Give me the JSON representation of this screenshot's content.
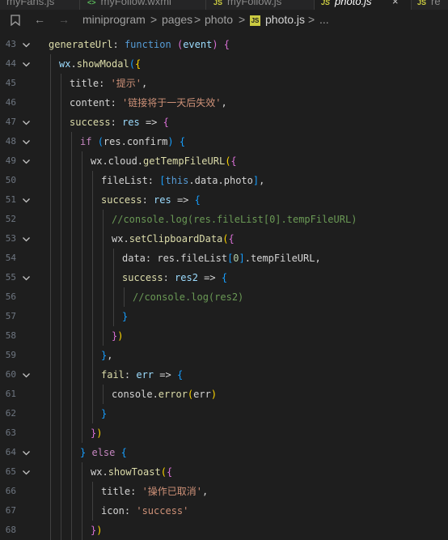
{
  "tabs": [
    {
      "icon": "",
      "label": "myFans.js"
    },
    {
      "icon": "<>",
      "label": "myFollow.wxml"
    },
    {
      "icon": "JS",
      "label": "myFollow.js"
    },
    {
      "icon": "JS",
      "label": "photo.js",
      "close": "×"
    },
    {
      "icon": "JS",
      "label": "re"
    }
  ],
  "breadcrumb": {
    "bookmark": "☐",
    "back": "←",
    "forward": "→",
    "segments": [
      "miniprogram",
      "pages",
      "photo"
    ],
    "sep": ">",
    "file_icon": "JS",
    "file": "photo.js",
    "tail": "..."
  },
  "editor": {
    "lines": [
      {
        "n": "43",
        "fold": true,
        "t": [
          [
            "generateUrl",
            "t-fn"
          ],
          [
            ": ",
            ""
          ],
          [
            "function",
            "t-kw"
          ],
          [
            " ",
            ""
          ],
          [
            "(",
            "t-br2"
          ],
          [
            "event",
            "t-var"
          ],
          [
            ")",
            "t-br2"
          ],
          [
            " ",
            ""
          ],
          [
            "{",
            "t-br2"
          ]
        ]
      },
      {
        "n": "44",
        "fold": true,
        "t": [
          [
            "wx",
            "t-var"
          ],
          [
            ".",
            ""
          ],
          [
            "showModal",
            "t-fn"
          ],
          [
            "(",
            "t-br3"
          ],
          [
            "{",
            "t-br1"
          ]
        ]
      },
      {
        "n": "45",
        "fold": false,
        "t": [
          [
            "title",
            ""
          ],
          [
            ": ",
            ""
          ],
          [
            "'提示'",
            "t-str"
          ],
          [
            ",",
            ""
          ]
        ]
      },
      {
        "n": "46",
        "fold": false,
        "t": [
          [
            "content",
            ""
          ],
          [
            ": ",
            ""
          ],
          [
            "'链接将于一天后失效'",
            "t-str"
          ],
          [
            ",",
            ""
          ]
        ]
      },
      {
        "n": "47",
        "fold": true,
        "t": [
          [
            "success",
            "t-fn"
          ],
          [
            ": ",
            ""
          ],
          [
            "res",
            "t-var"
          ],
          [
            " => ",
            ""
          ],
          [
            "{",
            "t-br2"
          ]
        ]
      },
      {
        "n": "48",
        "fold": true,
        "t": [
          [
            "if",
            "t-ctl"
          ],
          [
            " ",
            ""
          ],
          [
            "(",
            "t-br3"
          ],
          [
            "res.confirm",
            ""
          ],
          [
            ")",
            "t-br3"
          ],
          [
            " ",
            ""
          ],
          [
            "{",
            "t-br3"
          ]
        ]
      },
      {
        "n": "49",
        "fold": true,
        "t": [
          [
            "wx.cloud.",
            ""
          ],
          [
            "getTempFileURL",
            "t-fn"
          ],
          [
            "(",
            "t-br1"
          ],
          [
            "{",
            "t-br2"
          ]
        ]
      },
      {
        "n": "50",
        "fold": false,
        "t": [
          [
            "fileList",
            ""
          ],
          [
            ": ",
            ""
          ],
          [
            "[",
            "t-br3"
          ],
          [
            "this",
            "t-kw"
          ],
          [
            ".data.photo",
            ""
          ],
          [
            "]",
            "t-br3"
          ],
          [
            ",",
            ""
          ]
        ]
      },
      {
        "n": "51",
        "fold": true,
        "t": [
          [
            "success",
            "t-fn"
          ],
          [
            ": ",
            ""
          ],
          [
            "res",
            "t-var"
          ],
          [
            " => ",
            ""
          ],
          [
            "{",
            "t-br3"
          ]
        ]
      },
      {
        "n": "52",
        "fold": false,
        "t": [
          [
            "//console.log(res.fileList[0].tempFileURL)",
            "t-cmt"
          ]
        ]
      },
      {
        "n": "53",
        "fold": true,
        "t": [
          [
            "wx.",
            ""
          ],
          [
            "setClipboardData",
            "t-fn"
          ],
          [
            "(",
            "t-br1"
          ],
          [
            "{",
            "t-br2"
          ]
        ]
      },
      {
        "n": "54",
        "fold": false,
        "t": [
          [
            "data",
            ""
          ],
          [
            ": res.fileList",
            ""
          ],
          [
            "[",
            "t-br3"
          ],
          [
            "0",
            "t-num"
          ],
          [
            "]",
            "t-br3"
          ],
          [
            ".tempFileURL,",
            ""
          ]
        ]
      },
      {
        "n": "55",
        "fold": true,
        "t": [
          [
            "success",
            "t-fn"
          ],
          [
            ": ",
            ""
          ],
          [
            "res2",
            "t-var"
          ],
          [
            " => ",
            ""
          ],
          [
            "{",
            "t-br3"
          ]
        ]
      },
      {
        "n": "56",
        "fold": false,
        "t": [
          [
            "//console.log(res2)",
            "t-cmt"
          ]
        ]
      },
      {
        "n": "57",
        "fold": false,
        "t": [
          [
            "}",
            "t-br3"
          ]
        ]
      },
      {
        "n": "58",
        "fold": false,
        "t": [
          [
            "}",
            "t-br2"
          ],
          [
            ")",
            "t-br1"
          ]
        ]
      },
      {
        "n": "59",
        "fold": false,
        "t": [
          [
            "}",
            "t-br3"
          ],
          [
            ",",
            ""
          ]
        ]
      },
      {
        "n": "60",
        "fold": true,
        "t": [
          [
            "fail",
            "t-fn"
          ],
          [
            ": ",
            ""
          ],
          [
            "err",
            "t-var"
          ],
          [
            " => ",
            ""
          ],
          [
            "{",
            "t-br3"
          ]
        ]
      },
      {
        "n": "61",
        "fold": false,
        "t": [
          [
            "console.",
            ""
          ],
          [
            "error",
            "t-fn"
          ],
          [
            "(",
            "t-br1"
          ],
          [
            "err",
            ""
          ],
          [
            ")",
            "t-br1"
          ]
        ]
      },
      {
        "n": "62",
        "fold": false,
        "t": [
          [
            "}",
            "t-br3"
          ]
        ]
      },
      {
        "n": "63",
        "fold": false,
        "t": [
          [
            "}",
            "t-br2"
          ],
          [
            ")",
            "t-br1"
          ]
        ]
      },
      {
        "n": "64",
        "fold": true,
        "t": [
          [
            "}",
            "t-br3"
          ],
          [
            " ",
            ""
          ],
          [
            "else",
            "t-ctl"
          ],
          [
            " ",
            ""
          ],
          [
            "{",
            "t-br3"
          ]
        ]
      },
      {
        "n": "65",
        "fold": true,
        "t": [
          [
            "wx.",
            ""
          ],
          [
            "showToast",
            "t-fn"
          ],
          [
            "(",
            "t-br1"
          ],
          [
            "{",
            "t-br2"
          ]
        ]
      },
      {
        "n": "66",
        "fold": false,
        "t": [
          [
            "title",
            ""
          ],
          [
            ": ",
            ""
          ],
          [
            "'操作已取消'",
            "t-str"
          ],
          [
            ",",
            ""
          ]
        ]
      },
      {
        "n": "67",
        "fold": false,
        "t": [
          [
            "icon",
            ""
          ],
          [
            ": ",
            ""
          ],
          [
            "'success'",
            "t-str"
          ]
        ]
      },
      {
        "n": "68",
        "fold": false,
        "t": [
          [
            "}",
            "t-br2"
          ],
          [
            ")",
            "t-br1"
          ]
        ]
      }
    ]
  }
}
